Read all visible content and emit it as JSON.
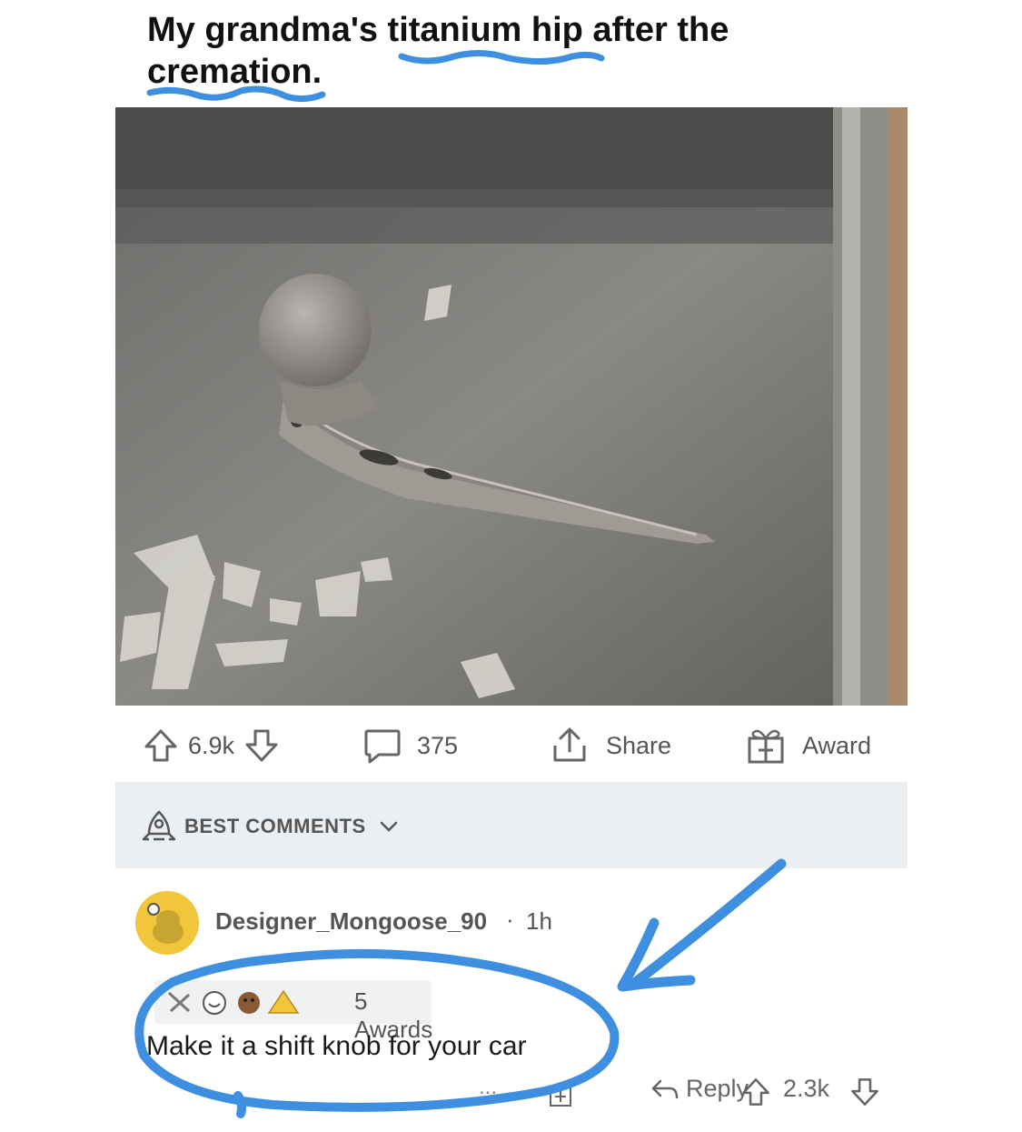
{
  "post": {
    "title": "My grandma's titanium hip after the cremation."
  },
  "actions": {
    "upvotes": "6.9k",
    "comments": "375",
    "share_label": "Share",
    "award_label": "Award"
  },
  "comments_header": {
    "sort_label": "BEST COMMENTS"
  },
  "comment": {
    "username": "Designer_Mongoose_90",
    "separator": "·",
    "age": "1h",
    "awards": "5 Awards",
    "body": "Make it a shift knob for your car",
    "reply_label": "Reply",
    "score": "2.3k",
    "more": "..."
  },
  "colors": {
    "annotation_blue": "#3f8fe0",
    "avatar_yellow": "#f2c63a",
    "bar_background": "#eceff2"
  }
}
